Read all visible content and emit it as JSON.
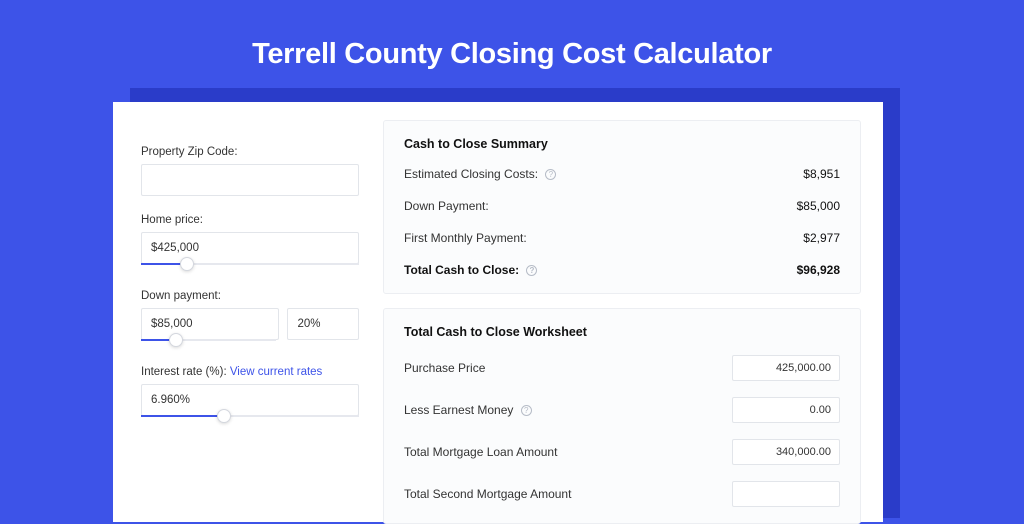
{
  "title": "Terrell County Closing Cost Calculator",
  "left": {
    "zip_label": "Property Zip Code:",
    "zip_value": "",
    "home_price_label": "Home price:",
    "home_price_value": "$425,000",
    "home_price_pct": 21,
    "down_payment_label": "Down payment:",
    "down_payment_value": "$85,000",
    "down_payment_pct_value": "20%",
    "down_payment_slider_pct": 25,
    "interest_label": "Interest rate (%): ",
    "interest_link": "View current rates",
    "interest_value": "6.960%",
    "interest_slider_pct": 38
  },
  "summary": {
    "heading": "Cash to Close Summary",
    "rows": [
      {
        "label": "Estimated Closing Costs:",
        "help": true,
        "value": "$8,951"
      },
      {
        "label": "Down Payment:",
        "help": false,
        "value": "$85,000"
      },
      {
        "label": "First Monthly Payment:",
        "help": false,
        "value": "$2,977"
      }
    ],
    "total_label": "Total Cash to Close:",
    "total_value": "$96,928"
  },
  "worksheet": {
    "heading": "Total Cash to Close Worksheet",
    "rows": [
      {
        "label": "Purchase Price",
        "help": false,
        "value": "425,000.00"
      },
      {
        "label": "Less Earnest Money",
        "help": true,
        "value": "0.00"
      },
      {
        "label": "Total Mortgage Loan Amount",
        "help": false,
        "value": "340,000.00"
      },
      {
        "label": "Total Second Mortgage Amount",
        "help": false,
        "value": ""
      }
    ]
  }
}
